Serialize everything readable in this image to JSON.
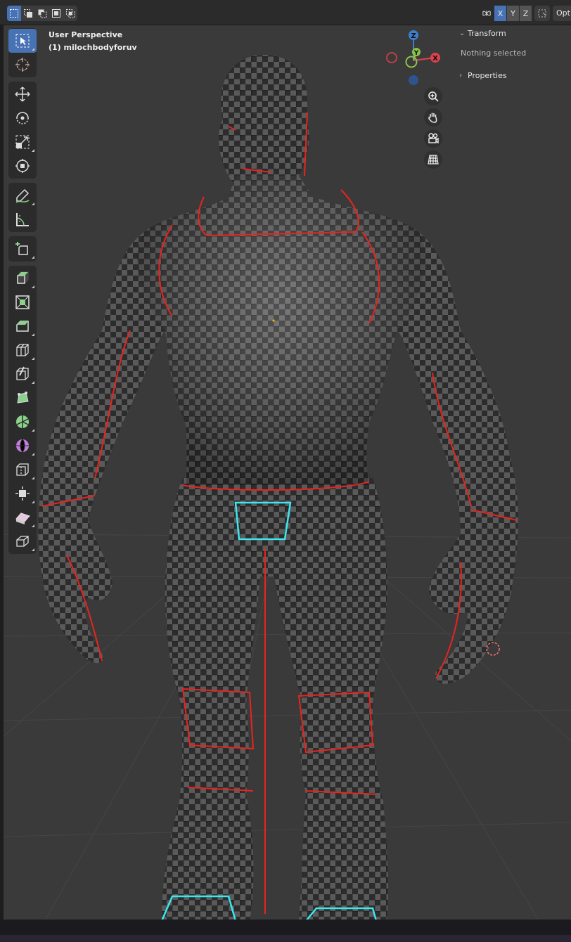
{
  "viewport": {
    "view_label": "User Perspective",
    "object_label": "(1) milochbodyforuv"
  },
  "header": {
    "select_modes": [
      "select-new-icon",
      "select-extend-icon",
      "select-subtract-icon",
      "select-invert-icon",
      "select-intersect-icon"
    ],
    "axis_buttons": [
      "X",
      "Y",
      "Z"
    ],
    "options_label": "Opt"
  },
  "toolbar": {
    "tools": [
      "select-box",
      "cursor",
      "move",
      "rotate",
      "scale",
      "transform",
      "annotate",
      "measure",
      "add-cube",
      "extrude-region",
      "inset-faces",
      "bevel",
      "loop-cut",
      "knife",
      "poly-build",
      "spin",
      "smooth",
      "edge-slide",
      "shrink-fatten",
      "shear",
      "rip-region"
    ]
  },
  "gizmo": {
    "x_label": "X",
    "y_label": "Y",
    "z_label": "Z",
    "x_color": "#e0414e",
    "y_color": "#8bc34a",
    "z_color": "#3d7fd0"
  },
  "sidebar": {
    "transform_title": "Transform",
    "transform_status": "Nothing selected",
    "properties_title": "Properties"
  },
  "colors": {
    "seam": "#e8241e",
    "selected": "#3be7f0",
    "active_blue": "#4772b3"
  }
}
